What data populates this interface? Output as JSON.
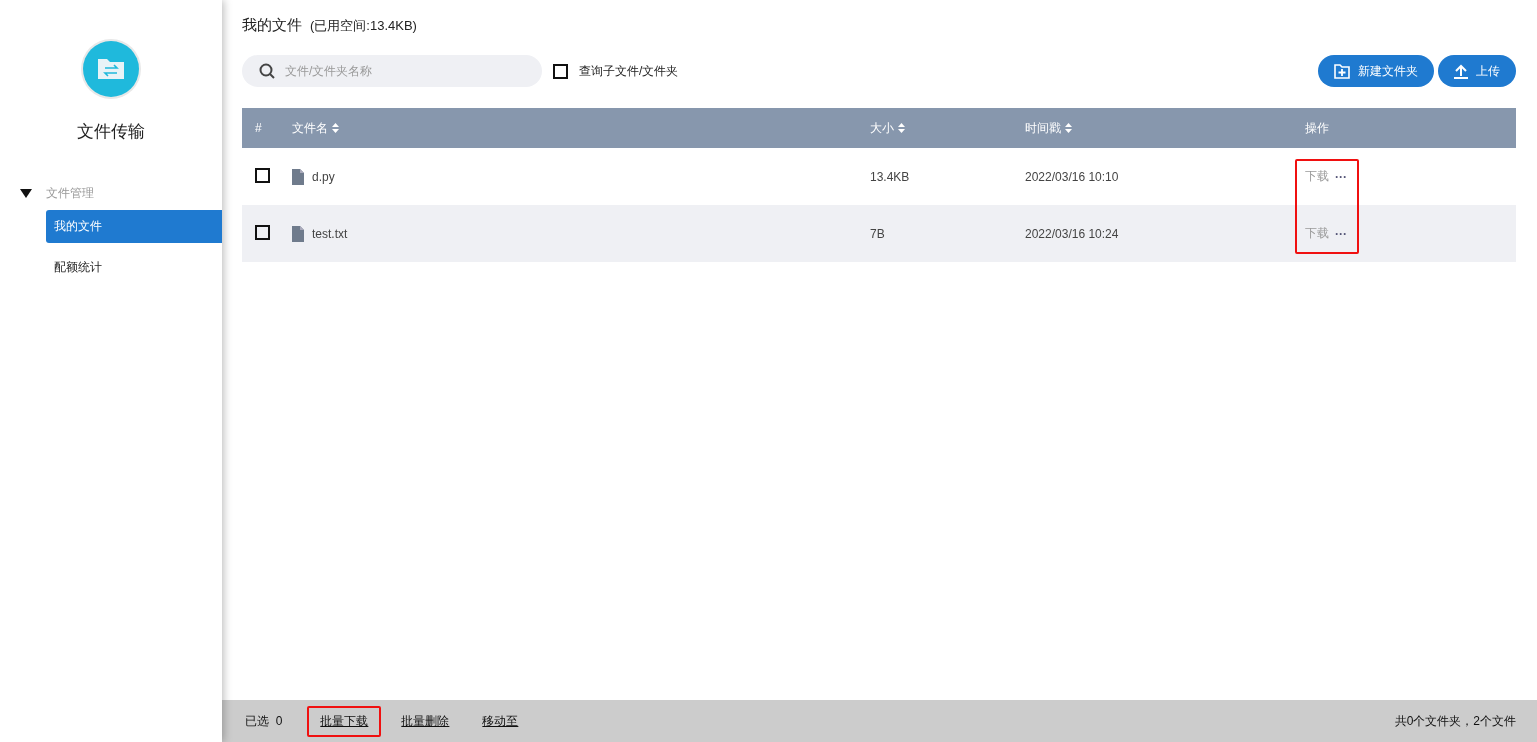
{
  "sidebar": {
    "app_name": "文件传输",
    "groups": [
      {
        "label": "文件管理",
        "expanded": true,
        "children": [
          {
            "label": "我的文件",
            "selected": true
          },
          {
            "label": "配额统计",
            "selected": false
          }
        ]
      }
    ]
  },
  "header": {
    "title": "我的文件",
    "usage": "(已用空间:13.4KB)"
  },
  "search": {
    "placeholder": "文件/文件夹名称"
  },
  "subfolder_checkbox": {
    "label": "查询子文件/文件夹",
    "checked": false
  },
  "buttons": [
    {
      "kind": "new-folder",
      "label": "新建文件夹"
    },
    {
      "kind": "upload",
      "label": "上传"
    }
  ],
  "table": {
    "columns": [
      {
        "label": "#",
        "sortable": false
      },
      {
        "label": "文件名",
        "sortable": true
      },
      {
        "label": "大小",
        "sortable": true
      },
      {
        "label": "时间戳",
        "sortable": true
      },
      {
        "label": "操作",
        "sortable": false
      }
    ],
    "actions_highlighted": true,
    "rows": [
      {
        "checked": false,
        "name": "d.py",
        "size": "13.4KB",
        "time": "2022/03/16 10:10",
        "action": "下载",
        "more": "···"
      },
      {
        "checked": false,
        "name": "test.txt",
        "size": "7B",
        "time": "2022/03/16 10:24",
        "action": "下载",
        "more": "···"
      }
    ]
  },
  "footer": {
    "selected_label": "已选",
    "selected_count": "0",
    "actions": [
      {
        "label": "批量下载",
        "highlighted": true
      },
      {
        "label": "批量删除",
        "highlighted": false
      },
      {
        "label": "移动至",
        "highlighted": false
      }
    ],
    "summary": "共0个文件夹，2个文件"
  }
}
